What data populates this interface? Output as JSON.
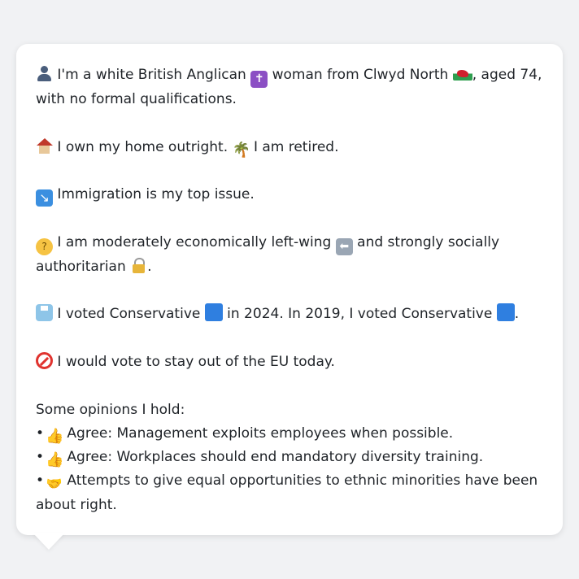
{
  "profile": {
    "p1": {
      "t1": "I'm a white British Anglican",
      "t2": "woman from Clwyd North",
      "t3": ", aged 74, with no formal qualifications."
    },
    "p2": {
      "t1": "I own my home outright.",
      "t2": "I am retired."
    },
    "p3": {
      "t1": "Immigration is my top issue."
    },
    "p4": {
      "t1": "I am moderately economically left-wing",
      "t2": "and strongly socially authoritarian",
      "t3": "."
    },
    "p5": {
      "t1": "I voted Conservative",
      "t2": "in 2024. In 2019, I voted Conservative",
      "t3": "."
    },
    "p6": {
      "t1": "I would vote to stay out of the EU today."
    },
    "opinions": {
      "heading": "Some opinions I hold:",
      "items": [
        {
          "bullet": "•",
          "text": "Agree: Management exploits employees when possible.",
          "icon": "thumbs-up-icon"
        },
        {
          "bullet": "•",
          "text": "Agree: Workplaces should end mandatory diversity training.",
          "icon": "thumbs-up-icon"
        },
        {
          "bullet": "•",
          "text": "Attempts to give equal opportunities to ethnic minorities have been about right.",
          "icon": "handshake-icon"
        }
      ]
    }
  },
  "icons": {
    "cross": "✝",
    "palm": "🌴",
    "arrow": "↘",
    "think": "?",
    "back": "⬅",
    "thumb": "👍",
    "hands": "🤝"
  },
  "colors": {
    "background": "#f1f2f4",
    "bubble": "#ffffff",
    "text": "#1f2328",
    "conservative_blue": "#2f7fe0"
  }
}
